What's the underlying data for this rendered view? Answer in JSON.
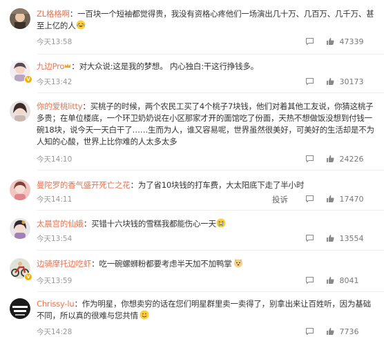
{
  "comments": [
    {
      "user": "ZL格格啊",
      "separator": "：",
      "text_before_emoji": "一百块一个短袖都觉得贵，我没有资格心疼他们一场演出几十万、几百万、几千万、甚至上亿的人",
      "emoji": "laugh-cry-emoji",
      "text_after_emoji": "",
      "time": "今天13:58",
      "likes": "47339",
      "report_label": ""
    },
    {
      "user": "九边Pro",
      "separator": "：",
      "text_before_emoji": "对大众说:这是我的梦想。 内心独白:干这行挣钱多。",
      "emoji": "",
      "text_after_emoji": "",
      "time": "今天13:42",
      "likes": "30173",
      "report_label": ""
    },
    {
      "user": "你的爱桃litty",
      "separator": "：",
      "text_before_emoji": "买桃子的时候，两个农民工买了4个桃子7块钱，他们对着其他工友说，你猜这桃子多贵；在单位楼底，一个环卫奶奶说在小区那家才开的面馆吃了份面，天热不想做饭没想到付钱一碗18块，说今天一天白干了……生而为人，谁又容易呢，世界虽然很美好，可美好的生活却是不为人知的心酸，世界上比你难的人太多太多",
      "emoji": "",
      "text_after_emoji": "",
      "time": "今天14:10",
      "likes": "24226",
      "report_label": ""
    },
    {
      "user": "曼陀罗的香气盛开死亡之花",
      "separator": "：",
      "text_before_emoji": "为了省10块钱的打车费，大太阳底下走了半小时",
      "emoji": "",
      "text_after_emoji": "",
      "time": "今天14:11",
      "likes": "17470",
      "report_label": "投诉"
    },
    {
      "user": "太晨宫的仙娥",
      "separator": "：",
      "text_before_emoji": "买错十六块钱的雪糕我都能伤心一天",
      "emoji": "crying-emoji",
      "text_after_emoji": "",
      "time": "今天13:54",
      "likes": "13554",
      "report_label": ""
    },
    {
      "user": "边骑摩托边吃虾",
      "separator": "：",
      "text_before_emoji": "吃一碗螺蛳粉都要考虑半天加不加鸭掌",
      "emoji": "doge-emoji",
      "text_after_emoji": "",
      "time": "今天13:59",
      "likes": "8041",
      "report_label": ""
    },
    {
      "user": "Chrissy-lu",
      "separator": "：",
      "text_before_emoji": "作为明星，你想卖穷的话在您们明星群里卖一卖得了，别拿出来让百姓听，因为基础不同，所以真的很难与您共情",
      "emoji": "smile-emoji",
      "text_after_emoji": "",
      "time": "今天14:28",
      "likes": "7736",
      "report_label": ""
    }
  ],
  "colors": {
    "username": "#eb7350",
    "text": "#333333",
    "meta": "#999999",
    "divider": "#efefef"
  }
}
